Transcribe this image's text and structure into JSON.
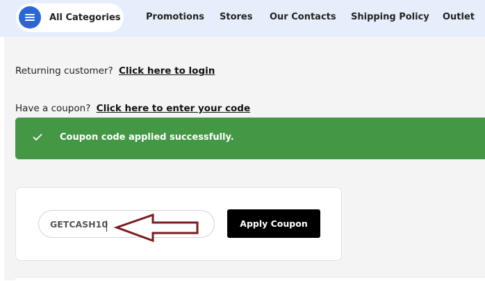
{
  "nav": {
    "categories_label": "All Categories",
    "items": [
      "Promotions",
      "Stores",
      "Our Contacts",
      "Shipping Policy",
      "Outlet"
    ]
  },
  "checkout": {
    "returning_prefix": "Returning customer?",
    "returning_link": "Click here to login",
    "coupon_prefix": "Have a coupon?",
    "coupon_link": "Click here to enter your code",
    "success_message": "Coupon code applied successfully.",
    "coupon_value": "GETCASH10",
    "apply_label": "Apply Coupon"
  },
  "colors": {
    "success": "#449745",
    "nav_bg": "#e7eefb",
    "menu_button": "#2b66d6",
    "annotation_arrow": "#7a1b1f"
  },
  "icons": [
    "menu-icon",
    "check-icon",
    "arrow-annotation"
  ]
}
